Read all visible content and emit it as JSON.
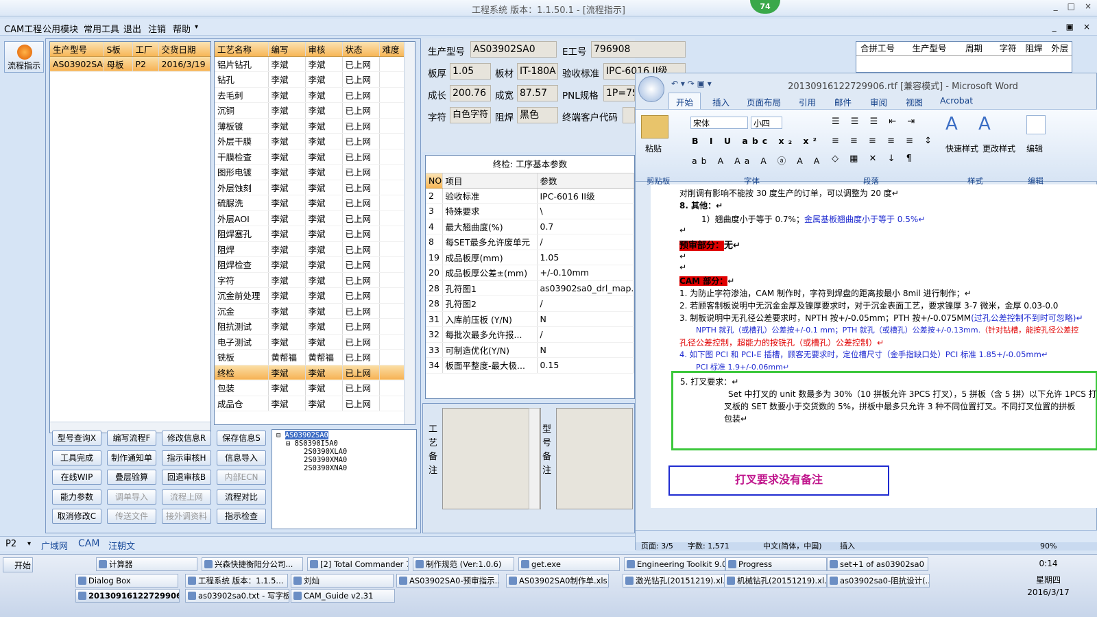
{
  "window": {
    "title": "工程系统  版本：1.1.50.1 - [流程指示]",
    "badge": "74",
    "controls": [
      "_",
      "□",
      "×"
    ],
    "mdi_controls": [
      "_",
      "▣",
      "×"
    ]
  },
  "menu": [
    "CAM工程",
    "公用模块",
    "常用工具",
    "退出",
    "注销",
    "帮助"
  ],
  "menu_dropdown": "▾",
  "left_tool": {
    "flow_button": "流程指示"
  },
  "order_table": {
    "headers": [
      "生产型号",
      "S板",
      "工厂",
      "交货日期"
    ],
    "rows": [
      [
        "AS03902SA0",
        "母板",
        "P2",
        "2016/3/19"
      ]
    ]
  },
  "process_table": {
    "headers": [
      "工艺名称",
      "编写",
      "审核",
      "状态",
      "难度"
    ],
    "rows": [
      [
        "铝片钻孔",
        "李斌",
        "李斌",
        "已上网",
        ""
      ],
      [
        "钻孔",
        "李斌",
        "李斌",
        "已上网",
        ""
      ],
      [
        "去毛刺",
        "李斌",
        "李斌",
        "已上网",
        ""
      ],
      [
        "沉铜",
        "李斌",
        "李斌",
        "已上网",
        ""
      ],
      [
        "薄板镀",
        "李斌",
        "李斌",
        "已上网",
        ""
      ],
      [
        "外层干膜",
        "李斌",
        "李斌",
        "已上网",
        ""
      ],
      [
        "干膜检查",
        "李斌",
        "李斌",
        "已上网",
        ""
      ],
      [
        "图形电镀",
        "李斌",
        "李斌",
        "已上网",
        ""
      ],
      [
        "外层蚀刻",
        "李斌",
        "李斌",
        "已上网",
        ""
      ],
      [
        "硫脲洗",
        "李斌",
        "李斌",
        "已上网",
        ""
      ],
      [
        "外层AOI",
        "李斌",
        "李斌",
        "已上网",
        ""
      ],
      [
        "阻焊塞孔",
        "李斌",
        "李斌",
        "已上网",
        ""
      ],
      [
        "阻焊",
        "李斌",
        "李斌",
        "已上网",
        ""
      ],
      [
        "阻焊检查",
        "李斌",
        "李斌",
        "已上网",
        ""
      ],
      [
        "字符",
        "李斌",
        "李斌",
        "已上网",
        ""
      ],
      [
        "沉金前处理",
        "李斌",
        "李斌",
        "已上网",
        ""
      ],
      [
        "沉金",
        "李斌",
        "李斌",
        "已上网",
        ""
      ],
      [
        "阻抗测试",
        "李斌",
        "李斌",
        "已上网",
        ""
      ],
      [
        "电子测试",
        "李斌",
        "李斌",
        "已上网",
        ""
      ],
      [
        "铣板",
        "黄帮福",
        "黄帮福",
        "已上网",
        ""
      ],
      [
        "终检",
        "李斌",
        "李斌",
        "已上网",
        ""
      ],
      [
        "包装",
        "李斌",
        "李斌",
        "已上网",
        ""
      ],
      [
        "成品仓",
        "李斌",
        "李斌",
        "已上网",
        ""
      ]
    ],
    "selected_index": 20
  },
  "buttons": [
    [
      "型号查询X",
      "编写流程F",
      "修改信息R",
      "保存信息S"
    ],
    [
      "工具完成",
      "制作通知单",
      "指示审核H",
      "信息导入"
    ],
    [
      "在线WIP",
      "叠层验算",
      "回退审核B",
      "内部ECN"
    ],
    [
      "能力参数",
      "调单导入",
      "流程上网",
      "流程对比"
    ],
    [
      "取消修改C",
      "传送文件",
      "接外调资料",
      "指示检查"
    ]
  ],
  "disabled_buttons": [
    "内部ECN",
    "调单导入",
    "流程上网",
    "传送文件",
    "接外调资料"
  ],
  "tree": {
    "root": "AS03902SA0",
    "child": "8S0390I5A0",
    "leaves": [
      "2S0390XLA0",
      "2S0390XMA0",
      "2S0390XNA0"
    ]
  },
  "info": {
    "prod_model_label": "生产型号",
    "prod_model": "AS03902SA0",
    "e_no_label": "E工号",
    "e_no": "796908",
    "thickness_label": "板厚",
    "thickness": "1.05",
    "material_label": "板材",
    "material": "IT-180A",
    "std_label": "验收标准",
    "std": "IPC-6016 II级",
    "length_label": "成长",
    "length": "200.76",
    "width_label": "成宽",
    "width": "87.57",
    "pnl_label": "PNL规格",
    "pnl": "1P=7S",
    "char_label": "字符",
    "char": "白色字符",
    "mask_label": "阻焊",
    "mask": "黑色",
    "customer_label": "终端客户代码"
  },
  "right_top_headers": [
    "合拼工号",
    "生产型号",
    "周期",
    "字符",
    "阻焊",
    "外层"
  ],
  "params": {
    "title": "终检: 工序基本参数",
    "headers": [
      "NO",
      "项目",
      "参数"
    ],
    "rows": [
      [
        "2",
        "验收标准",
        "IPC-6016 II级"
      ],
      [
        "3",
        "特殊要求",
        "\\"
      ],
      [
        "4",
        "最大翘曲度(%)",
        "0.7"
      ],
      [
        "8",
        "每SET最多允许废单元",
        "/"
      ],
      [
        "19",
        "成品板厚(mm)",
        "1.05"
      ],
      [
        "20",
        "成品板厚公差±(mm)",
        "+/-0.10mm"
      ],
      [
        "28",
        "孔符图1",
        "as03902sa0_drl_map.p"
      ],
      [
        "28",
        "孔符图2",
        "/"
      ],
      [
        "31",
        "入库前压板 (Y/N)",
        "N"
      ],
      [
        "32",
        "每批次最多允许报...",
        "/"
      ],
      [
        "33",
        "可制造优化(Y/N)",
        "N"
      ],
      [
        "34",
        "板面平整度-最大极...",
        "0.15"
      ]
    ]
  },
  "notes": {
    "process_label": "工艺备注",
    "model_label": "型号备注"
  },
  "bottom_tabs": [
    "P2",
    "▾",
    "广域网",
    "CAM",
    "汪朝文"
  ],
  "word": {
    "title": "20130916122729906.rtf [兼容模式] - Microsoft Word",
    "tabs": [
      "开始",
      "插入",
      "页面布局",
      "引用",
      "邮件",
      "审阅",
      "视图",
      "Acrobat"
    ],
    "font": "宋体",
    "size": "小四",
    "groups": [
      "剪贴板",
      "字体",
      "段落",
      "样式",
      "编辑"
    ],
    "big_buttons": [
      "粘贴",
      "快速样式",
      "更改样式",
      "编辑"
    ],
    "status": {
      "page": "页面: 3/5",
      "words": "字数: 1,571",
      "lang": "中文(简体，中国)",
      "mode": "插入",
      "zoom": "90%"
    },
    "lines": [
      "对削调有影响不能按 30 度生产的订单，可以调整为 20 度↵",
      "8.  其他：↵",
      "1）翘曲度小于等于 0.7%；",
      "金属基板翘曲度小于等于 0.5%↵",
      "↵",
      "预审部分：",
      "无↵",
      "↵",
      "↵",
      "CAM 部分：",
      "↵",
      "1.   为防止字符渗油，CAM 制作时，字符到焊盘的距离按最小 8mil 进行制作；↵",
      "2.   若顾客制板说明中无沉金金厚及镍厚要求时，对于沉金表面工艺，要求镍厚 3-7 微米，金厚 0.03-0.0",
      "3.   制板说明中无孔径公差要求时，NPTH 按+/-0.05mm；PTH 按+/-0.075MM",
      "(过孔公差控制不到时可忽略)↵",
      "NPTH 就孔（或槽孔）公差按+/-0.1 mm；PTH 就孔（或槽孔）公差按+/-0.13mm.",
      "（针对钻槽，能按孔径公差控",
      "孔径公差控制，超能力的按铣孔（或槽孔）公差控制）↵",
      "4.   如下图 PCI 和 PCI-E 插槽，顾客无要求时，定位槽尺寸（金手指缺口处）PCI 标准 1.85+/-0.05mm↵",
      "PCI 标准 1.9+/-0.06mm↵",
      "5. 打叉要求：↵",
      "Set 中打叉的 unit 数最多为 30%（10 拼板允许 3PCS 打叉），5 拼板（含 5 拼）以下允许 1PCS 打",
      "叉板的 SET 数要小于交货数的 5%，拼板中最多只允许 3 种不同位置打叉。不同打叉位置的拼板",
      "包装↵",
      "打叉要求没有备注"
    ]
  },
  "taskbar": {
    "start": "开始",
    "clock": "0:14",
    "day": "星期四",
    "date": "2016/3/17",
    "row1": [
      "计算器",
      "兴森快捷衡阳分公司...",
      "[2] Total Commander 7....",
      "制作规范 (Ver:1.0.6)",
      "get.exe",
      "Engineering Toolkit 9.0...",
      "Progress",
      "set+1 of as03902sa0"
    ],
    "row2": [
      "Dialog Box",
      "工程系统  版本：1.1.5...",
      "刘灿",
      "AS03902SA0-预审指示...",
      "AS03902SA0制作单.xls ...",
      "激光钻孔(20151219).xl...",
      "机械钻孔(20151219).xl...",
      "as03902sa0-阻抗设计(..."
    ],
    "row3": [
      "20130916122729906....",
      "as03902sa0.txt - 写字板",
      "CAM_Guide v2.31"
    ]
  },
  "colors": {
    "header_orange": "#f7b657",
    "green_box": "#3cc83c",
    "blue_box": "#1f2bd0",
    "red_highlight": "#e00000"
  }
}
